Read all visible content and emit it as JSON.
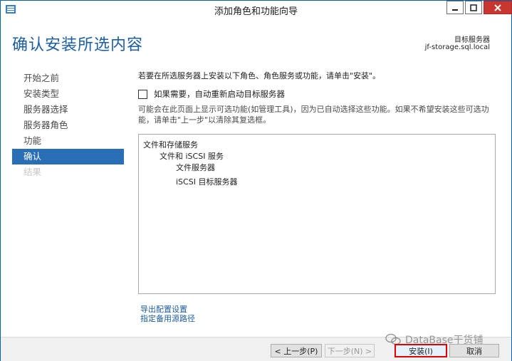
{
  "window": {
    "title": "添加角色和功能向导"
  },
  "header": {
    "page_title": "确认安装所选内容",
    "dest_label": "目标服务器",
    "dest_server": "jf-storage.sql.local"
  },
  "nav": {
    "items": [
      {
        "label": "开始之前"
      },
      {
        "label": "安装类型"
      },
      {
        "label": "服务器选择"
      },
      {
        "label": "服务器角色"
      },
      {
        "label": "功能"
      },
      {
        "label": "确认"
      },
      {
        "label": "结果"
      }
    ]
  },
  "main": {
    "intro": "若要在所选服务器上安装以下角色、角色服务或功能，请单击\"安装\"。",
    "restart_label": "如果需要，自动重新启动目标服务器",
    "restart_checked": false,
    "note": "可能会在此页面上显示可选功能(如管理工具)，因为已自动选择这些功能。如果不希望安装这些可选功能，请单击\"上一步\"以清除其复选框。",
    "selection": [
      {
        "label": "文件和存储服务"
      },
      {
        "label": "文件和 iSCSI 服务"
      },
      {
        "label": "文件服务器"
      },
      {
        "label": "iSCSI 目标服务器"
      }
    ],
    "links": {
      "export": "导出配置设置",
      "source": "指定备用源路径"
    }
  },
  "footer": {
    "prev": "< 上一步(P)",
    "next": "下一步(N) >",
    "install": "安装(I)",
    "cancel": "取消"
  },
  "watermark": {
    "text": "DataBase干货铺"
  },
  "colors": {
    "accent": "#1c5ea4",
    "nav_active": "#2a6fb5",
    "close_button": "#c7372f",
    "highlight_border": "#e00000"
  }
}
